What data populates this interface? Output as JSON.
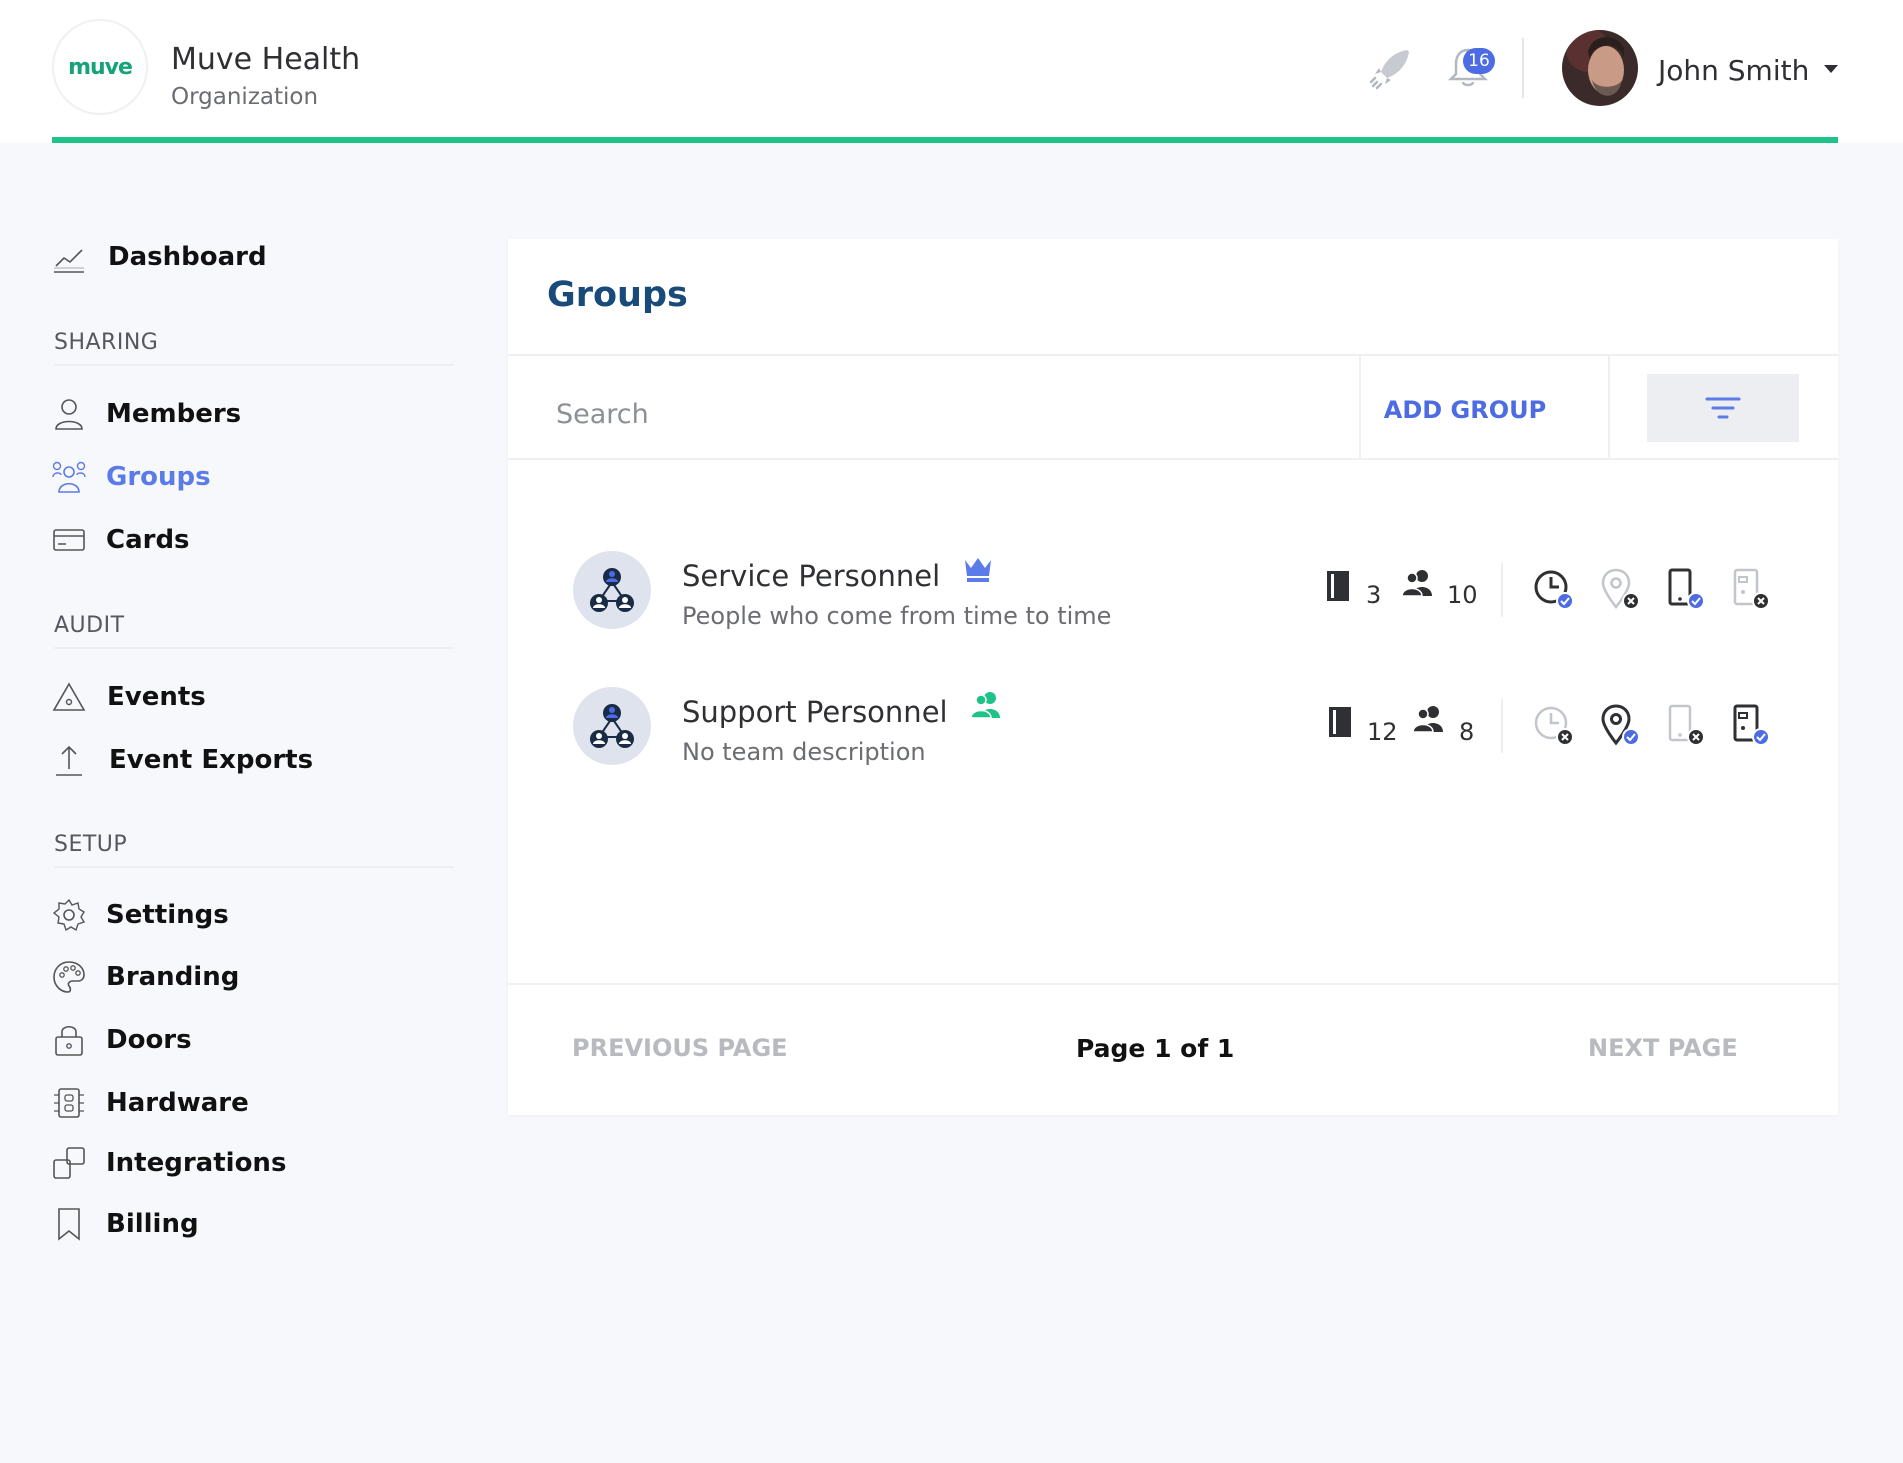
{
  "header": {
    "logo_text": "muve",
    "org_name": "Muve Health",
    "org_subtitle": "Organization",
    "notification_count": "16",
    "user_name": "John Smith",
    "icons": [
      "rocket-icon",
      "bell-icon",
      "chevron-down-icon"
    ]
  },
  "colors": {
    "accent": "#1ec388",
    "primary": "#4d6be3",
    "title": "#184a7a",
    "active_nav": "#5b7be8"
  },
  "sidebar": {
    "dashboard": "Dashboard",
    "sections": [
      {
        "label": "SHARING",
        "items": [
          {
            "label": "Members",
            "icon": "person-icon"
          },
          {
            "label": "Groups",
            "icon": "group-icon",
            "active": true
          },
          {
            "label": "Cards",
            "icon": "card-icon"
          }
        ]
      },
      {
        "label": "AUDIT",
        "items": [
          {
            "label": "Events",
            "icon": "warning-triangle-icon"
          },
          {
            "label": "Event Exports",
            "icon": "upload-icon"
          }
        ]
      },
      {
        "label": "SETUP",
        "items": [
          {
            "label": "Settings",
            "icon": "gear-icon"
          },
          {
            "label": "Branding",
            "icon": "palette-icon"
          },
          {
            "label": "Doors",
            "icon": "lock-icon"
          },
          {
            "label": "Hardware",
            "icon": "chip-icon"
          },
          {
            "label": "Integrations",
            "icon": "integrations-icon"
          },
          {
            "label": "Billing",
            "icon": "bookmark-icon"
          }
        ]
      }
    ]
  },
  "main": {
    "title": "Groups",
    "search_placeholder": "Search",
    "add_group_label": "ADD GROUP",
    "groups": [
      {
        "name": "Service Personnel",
        "description": "People who come from time to time",
        "badge": "crown-icon",
        "doors": "3",
        "members": "10",
        "permissions": {
          "schedule": "enabled",
          "location": "disabled",
          "mobile": "enabled",
          "card_reader": "disabled"
        }
      },
      {
        "name": "Support Personnel",
        "description": "No team description",
        "badge": "team-icon",
        "doors": "12",
        "members": "8",
        "permissions": {
          "schedule": "disabled",
          "location": "enabled",
          "mobile": "disabled",
          "card_reader": "enabled"
        }
      }
    ],
    "pagination": {
      "previous": "PREVIOUS PAGE",
      "status": "Page 1 of 1",
      "next": "NEXT PAGE"
    }
  }
}
